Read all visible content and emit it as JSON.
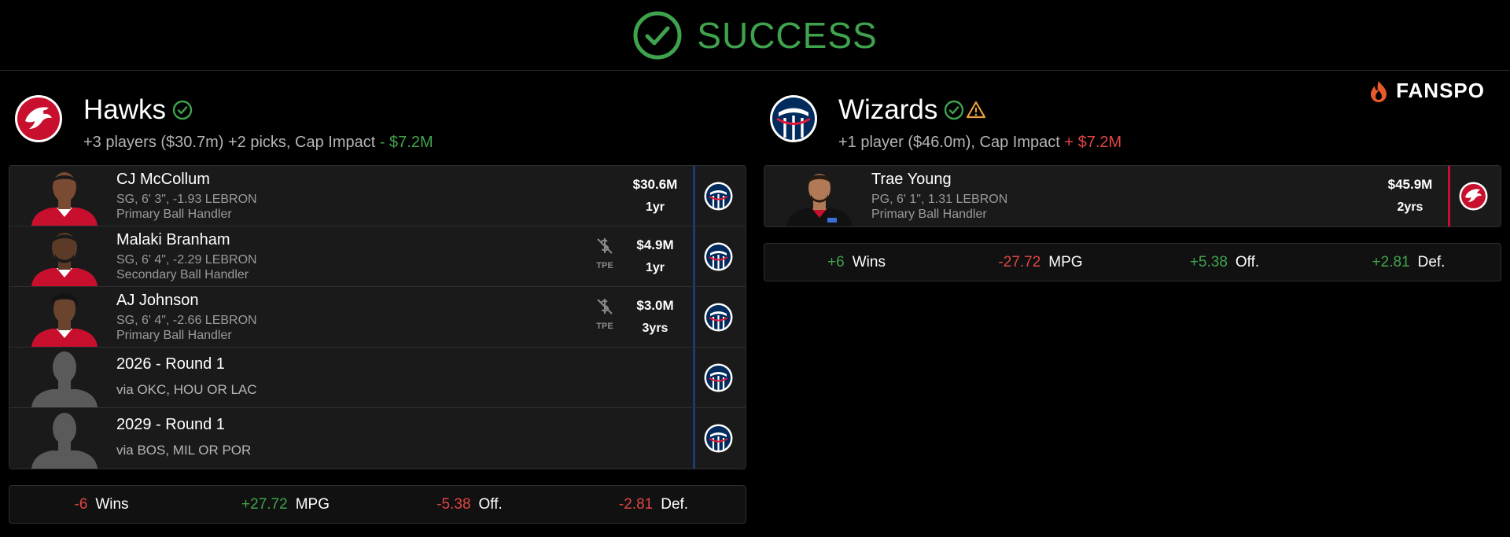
{
  "banner": {
    "title": "SUCCESS"
  },
  "brand": {
    "name": "FANSPO"
  },
  "colors": {
    "success": "#3fa34d",
    "negative": "#e04545",
    "wizards_bar": "#1d3a78",
    "hawks_bar": "#c8102e",
    "warning": "#e8a13a"
  },
  "teams": [
    {
      "name": "Hawks",
      "logo_icon": "hawks-logo-icon",
      "summary_prefix": "+3 players ($30.7m) +2 picks, Cap Impact ",
      "cap_impact": "- $7.2M",
      "rows": [
        {
          "kind": "player",
          "name": "CJ McCollum",
          "info": "SG, 6' 3\", -1.93 LEBRON",
          "role": "Primary Ball Handler",
          "salary": "$30.6M",
          "years": "1yr",
          "tpe": ""
        },
        {
          "kind": "player",
          "name": "Malaki Branham",
          "info": "SG, 6' 4\", -2.29 LEBRON",
          "role": "Secondary Ball Handler",
          "salary": "$4.9M",
          "years": "1yr",
          "tpe": "TPE"
        },
        {
          "kind": "player",
          "name": "AJ Johnson",
          "info": "SG, 6' 4\", -2.66 LEBRON",
          "role": "Primary Ball Handler",
          "salary": "$3.0M",
          "years": "3yrs",
          "tpe": "TPE"
        },
        {
          "kind": "pick",
          "name": "2026 - Round 1",
          "via": "via OKC, HOU OR LAC"
        },
        {
          "kind": "pick",
          "name": "2029 - Round 1",
          "via": "via BOS, MIL OR POR"
        }
      ],
      "stats": [
        {
          "value": "-6",
          "label": "Wins",
          "sign": "neg"
        },
        {
          "value": "+27.72",
          "label": "MPG",
          "sign": "pos"
        },
        {
          "value": "-5.38",
          "label": "Off.",
          "sign": "neg"
        },
        {
          "value": "-2.81",
          "label": "Def.",
          "sign": "neg"
        }
      ]
    },
    {
      "name": "Wizards",
      "logo_icon": "wizards-logo-icon",
      "summary_prefix": "+1 player ($46.0m), Cap Impact ",
      "cap_impact": "+ $7.2M",
      "rows": [
        {
          "kind": "player",
          "name": "Trae Young",
          "info": "PG, 6' 1\", 1.31 LEBRON",
          "role": "Primary Ball Handler",
          "salary": "$45.9M",
          "years": "2yrs",
          "tpe": ""
        }
      ],
      "stats": [
        {
          "value": "+6",
          "label": "Wins",
          "sign": "pos"
        },
        {
          "value": "-27.72",
          "label": "MPG",
          "sign": "neg"
        },
        {
          "value": "+5.38",
          "label": "Off.",
          "sign": "pos"
        },
        {
          "value": "+2.81",
          "label": "Def.",
          "sign": "pos"
        }
      ]
    }
  ]
}
